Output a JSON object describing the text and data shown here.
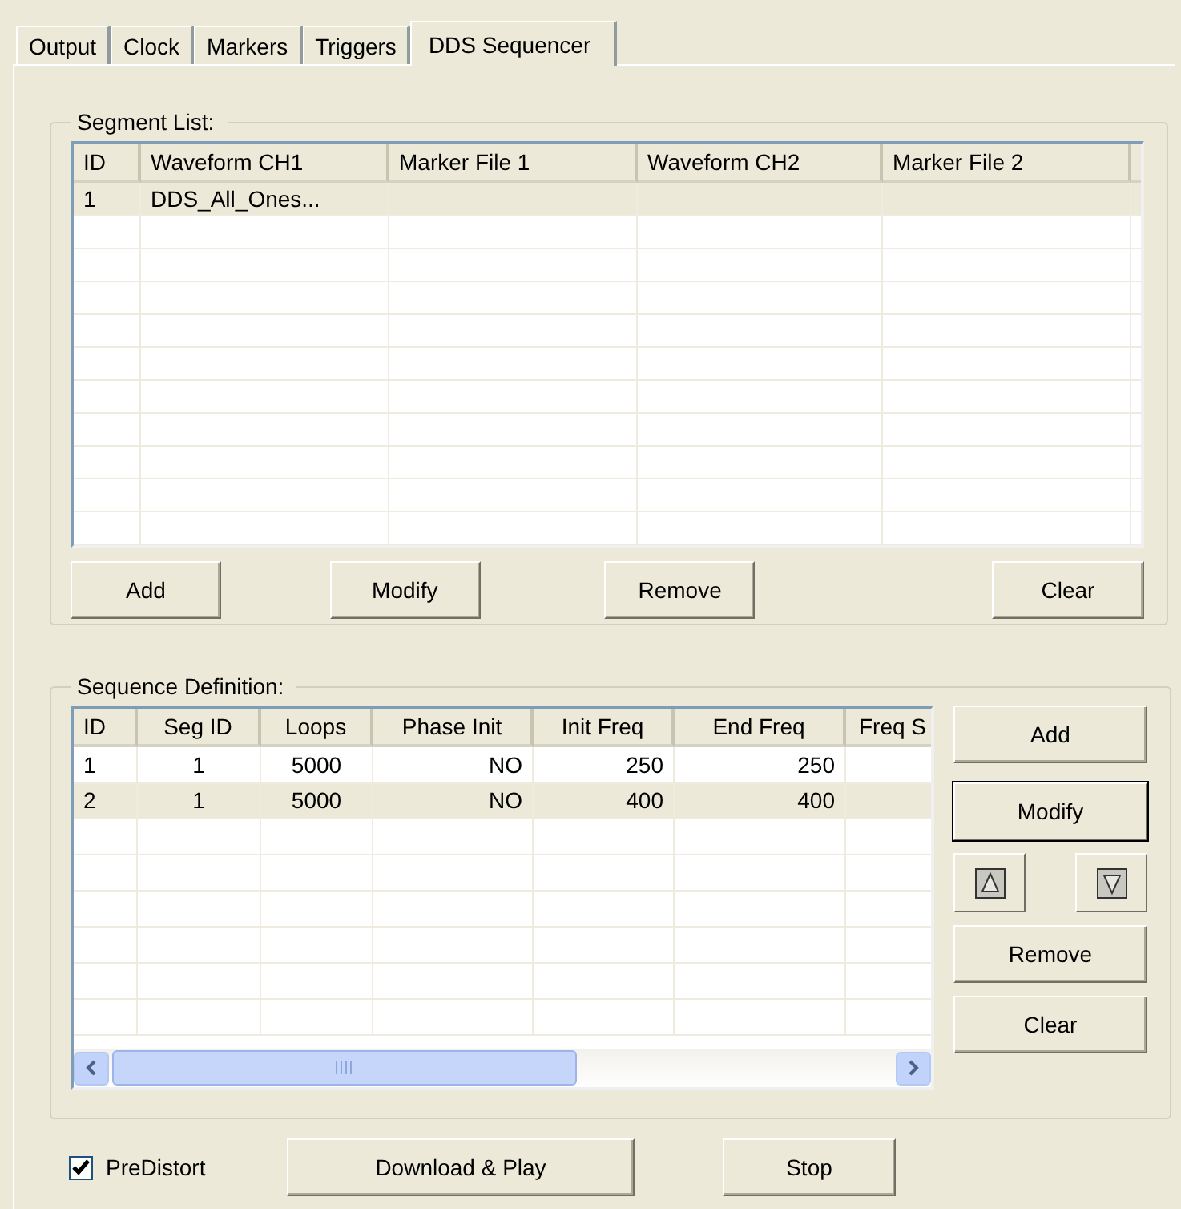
{
  "tabs": [
    {
      "label": "Output",
      "selected": false
    },
    {
      "label": "Clock",
      "selected": false
    },
    {
      "label": "Markers",
      "selected": false
    },
    {
      "label": "Triggers",
      "selected": false
    },
    {
      "label": "DDS Sequencer",
      "selected": true
    }
  ],
  "segment_list": {
    "title": "Segment List:",
    "columns": [
      "ID",
      "Waveform CH1",
      "Marker File 1",
      "Waveform CH2",
      "Marker File 2"
    ],
    "rows": [
      {
        "cells": [
          "1",
          "DDS_All_Ones...",
          "",
          "",
          ""
        ],
        "selected": true
      }
    ],
    "buttons": [
      {
        "label": "Add",
        "default": false
      },
      {
        "label": "Modify",
        "default": false
      },
      {
        "label": "Remove",
        "default": false
      },
      {
        "label": "Clear",
        "default": false
      }
    ]
  },
  "sequence_definition": {
    "title": "Sequence Definition:",
    "columns": [
      "ID",
      "Seg ID",
      "Loops",
      "Phase Init",
      "Init Freq",
      "End  Freq",
      "Freq S"
    ],
    "rows": [
      {
        "cells": [
          "1",
          "1",
          "5000",
          "NO",
          "250",
          "250",
          ""
        ],
        "selected": false
      },
      {
        "cells": [
          "2",
          "1",
          "5000",
          "NO",
          "400",
          "400",
          ""
        ],
        "selected": true
      }
    ],
    "buttons": [
      {
        "label": "Add",
        "default": false
      },
      {
        "label": "Modify",
        "default": true
      },
      {
        "label": "Remove",
        "default": false
      },
      {
        "label": "Clear",
        "default": false
      }
    ]
  },
  "predistort": {
    "label": "PreDistort",
    "checked": true
  },
  "actions": [
    {
      "label": "Download & Play"
    },
    {
      "label": "Stop"
    }
  ]
}
